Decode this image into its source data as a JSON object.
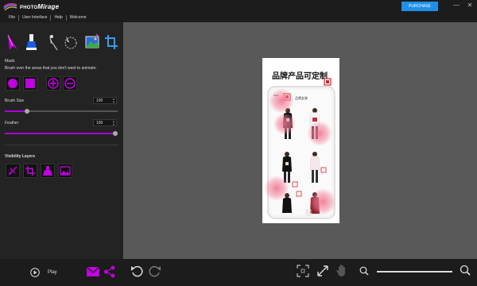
{
  "app": {
    "brand_small": "PHOTO",
    "brand_large": "Mirage",
    "purchase_label": "PURCHASE",
    "window_controls": {
      "minimize": "—",
      "close": "✕"
    }
  },
  "menu": {
    "items": [
      "File",
      "User Interface",
      "Help",
      "Welcome"
    ]
  },
  "mask": {
    "label": "Mask:",
    "hint": "Brush over the areas that you don't want to animate.",
    "brush_size_label": "Brush Size",
    "brush_size": "100",
    "feather_label": "Feather",
    "feather": "100",
    "brush_level": 0.2,
    "feather_level": 0.98
  },
  "visibility": {
    "label": "Visibility Layers"
  },
  "tools": [
    "motion-arrow-icon",
    "mask-brush-icon",
    "anchor-pin-icon",
    "selection-circle-icon",
    "sky-image-icon",
    "crop-icon"
  ],
  "photo": {
    "headline": "品牌产品可定制",
    "phone_time": "9:41",
    "phone_header": "品牌女装",
    "watermark": "酷"
  },
  "playback": {
    "play_label": "Play"
  },
  "colors": {
    "accent": "#b000d8",
    "purchase": "#1e90e6",
    "panel": "#232323",
    "canvas": "#595959"
  }
}
